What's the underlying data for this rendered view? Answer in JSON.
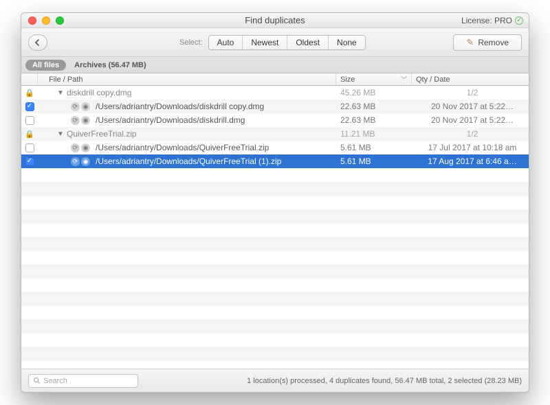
{
  "titlebar": {
    "title": "Find duplicates",
    "license_label": "License: PRO"
  },
  "toolbar": {
    "select_label": "Select:",
    "seg": [
      "Auto",
      "Newest",
      "Oldest",
      "None"
    ],
    "remove_label": "Remove"
  },
  "tabs": {
    "all_files": "All files",
    "archives": "Archives (56.47 MB)"
  },
  "columns": {
    "file": "File / Path",
    "size": "Size",
    "date": "Qty / Date"
  },
  "groups": [
    {
      "name": "diskdrill copy.dmg",
      "size": "45.26 MB",
      "qty": "1/2",
      "lock_icon": "lock-icon",
      "items": [
        {
          "checked": true,
          "path": "/Users/adriantry/Downloads/diskdrill copy.dmg",
          "size": "22.63 MB",
          "date": "20 Nov 2017 at 5:22…"
        },
        {
          "checked": false,
          "path": "/Users/adriantry/Downloads/diskdrill.dmg",
          "size": "22.63 MB",
          "date": "20 Nov 2017 at 5:22…"
        }
      ]
    },
    {
      "name": "QuiverFreeTrial.zip",
      "size": "11.21 MB",
      "qty": "1/2",
      "lock_icon": "lock-icon",
      "items": [
        {
          "checked": false,
          "path": "/Users/adriantry/Downloads/QuiverFreeTrial.zip",
          "size": "5.61 MB",
          "date": "17 Jul 2017 at 10:18 am"
        },
        {
          "checked": true,
          "path": "/Users/adriantry/Downloads/QuiverFreeTrial (1).zip",
          "size": "5.61 MB",
          "date": "17 Aug 2017 at 6:46 a…",
          "selected": true
        }
      ]
    }
  ],
  "search": {
    "placeholder": "Search"
  },
  "status": "1 location(s) processed, 4 duplicates found, 56.47 MB total, 2 selected (28.23 MB)"
}
